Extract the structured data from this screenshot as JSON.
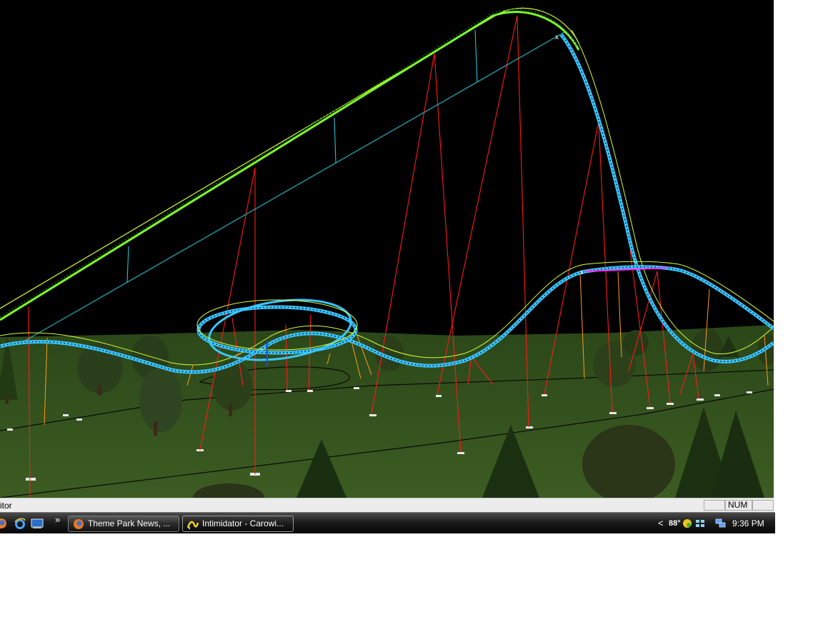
{
  "window": {
    "status_text": "itor",
    "status_panes": [
      "",
      "NUM",
      ""
    ]
  },
  "scene": {
    "description_icons": [
      "coaster-track",
      "support-pole",
      "pine-tree",
      "grass-terrain"
    ],
    "colors": {
      "sky": "#000000",
      "grass": "#2f4f1a",
      "lift_rail": "#9bff3a",
      "track_rail": "#39c6ff",
      "spine": "#b8ff2a",
      "support_red": "#ff1a1a",
      "support_orange": "#ff9a1a",
      "catwalk": "#ff2aff"
    }
  },
  "taskbar": {
    "quick_launch": [
      {
        "icon": "firefox-icon"
      },
      {
        "icon": "internet-explorer-icon"
      },
      {
        "icon": "show-desktop-icon"
      }
    ],
    "overflow_label": "»",
    "buttons": [
      {
        "label": "Theme Park News, ...",
        "icon": "firefox-icon",
        "active": false
      },
      {
        "label": "Intimidator - Carowi...",
        "icon": "nolimits-coaster-icon",
        "active": true
      }
    ],
    "tray": {
      "expand_label": "<",
      "temperature": "88°",
      "icons": [
        "weather-icon",
        "dropbox-icon",
        "network-icon"
      ],
      "clock": "9:36 PM"
    }
  }
}
